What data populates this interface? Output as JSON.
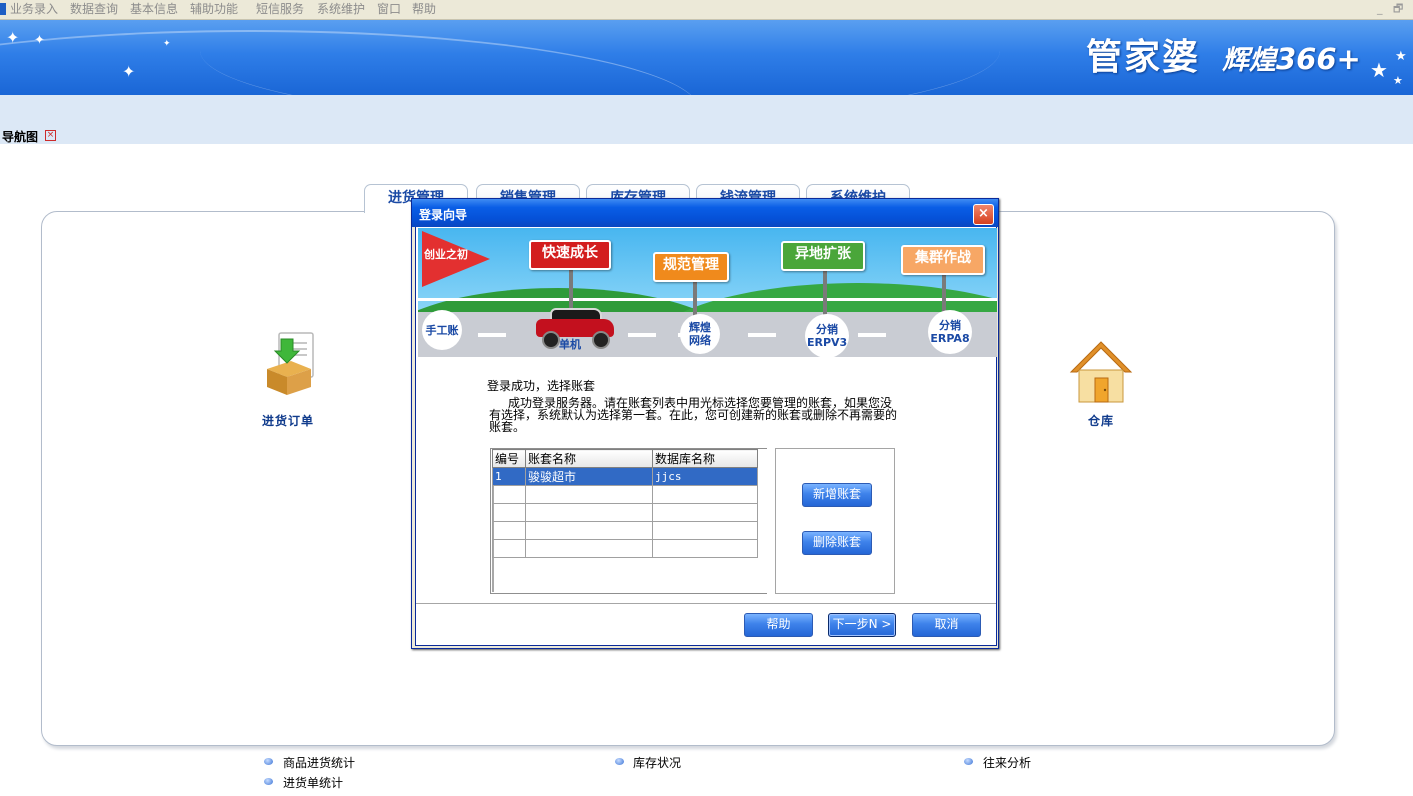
{
  "menu": [
    "业务录入",
    "数据查询",
    "基本信息",
    "辅助功能",
    "短信服务",
    "系统维护",
    "窗口",
    "帮助"
  ],
  "window_controls": {
    "minimize": "_",
    "restore": "🗗"
  },
  "brand": {
    "name": "管家婆",
    "edition": "辉煌",
    "version": "366",
    "plus": "+"
  },
  "nav": {
    "title": "导航图",
    "close": "×"
  },
  "tabs": [
    "进货管理",
    "销售管理",
    "库存管理",
    "钱流管理",
    "系统维护"
  ],
  "panel": {
    "left_icon_label": "进货订单",
    "right_icon_label": "仓库"
  },
  "bottom_links": [
    "商品进货统计",
    "进货单统计",
    "库存状况",
    "往来分析"
  ],
  "dialog": {
    "title": "登录向导",
    "close": "×",
    "illustration": {
      "flag": "创业之初",
      "signs": [
        "快速成长",
        "规范管理",
        "异地扩张",
        "集群作战"
      ],
      "stages": [
        "手工账",
        "单机",
        "辉煌网络",
        "分销ERPV3",
        "分销ERPA8"
      ]
    },
    "message_title": "登录成功，选择账套",
    "message_body": "成功登录服务器。请在账套列表中用光标选择您要管理的账套，如果您没有选择，系统默认为选择第一套。在此，您可创建新的账套或删除不再需要的账套。",
    "columns": [
      "编号",
      "账套名称",
      "数据库名称"
    ],
    "rows": [
      [
        "1",
        "骏骏超市",
        "jjcs"
      ],
      [
        "",
        "",
        ""
      ],
      [
        "",
        "",
        ""
      ],
      [
        "",
        "",
        ""
      ],
      [
        "",
        "",
        ""
      ]
    ],
    "add_button": "新增账套",
    "delete_button": "删除账套",
    "help_button": "帮助",
    "next_button": "下一步N >",
    "cancel_button": "取消"
  }
}
